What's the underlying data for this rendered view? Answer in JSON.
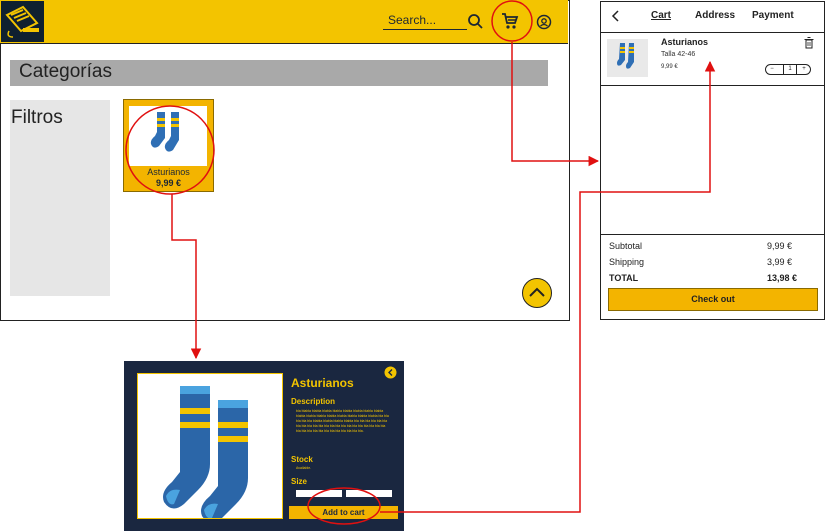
{
  "header": {
    "search_placeholder": "Search...",
    "icons": [
      "logo-icon",
      "search-icon",
      "cart-icon",
      "user-icon"
    ]
  },
  "main": {
    "categories_title": "Categorías",
    "filters_title": "Filtros",
    "product": {
      "name": "Asturianos",
      "price": "9,99 €"
    }
  },
  "cart": {
    "tabs": [
      "Cart",
      "Address",
      "Payment"
    ],
    "item": {
      "name": "Asturianos",
      "size": "Talla 42-46",
      "price": "9,99 €",
      "quantity": "1"
    },
    "summary": {
      "subtotal_label": "Subtotal",
      "subtotal_value": "9,99 €",
      "shipping_label": "Shipping",
      "shipping_value": "3,99 €",
      "total_label": "TOTAL",
      "total_value": "13,98 €"
    },
    "checkout_label": "Check out"
  },
  "detail": {
    "name": "Asturianos",
    "description_heading": "Description",
    "description_text": "bla blabla blabla blabla blabla blabla blabla blabla blabla blabla blabla blabla blabla blabla blabla blabla blabla bla bla bla bla bla blabla blabla blabla blabla bla bla bla bla bla bla bla bla bla bla bla bla bla bla bla bla bla bla bla bla bla bla bla bla bla bla bla bla bla bla bla bla bla bla.",
    "stock_heading": "Stock",
    "stock_text": "Available.",
    "size_heading": "Size",
    "add_to_cart_label": "Add to cart"
  },
  "colors": {
    "accent": "#f3c400",
    "dark": "#1a2740",
    "arrow": "#e01010"
  }
}
